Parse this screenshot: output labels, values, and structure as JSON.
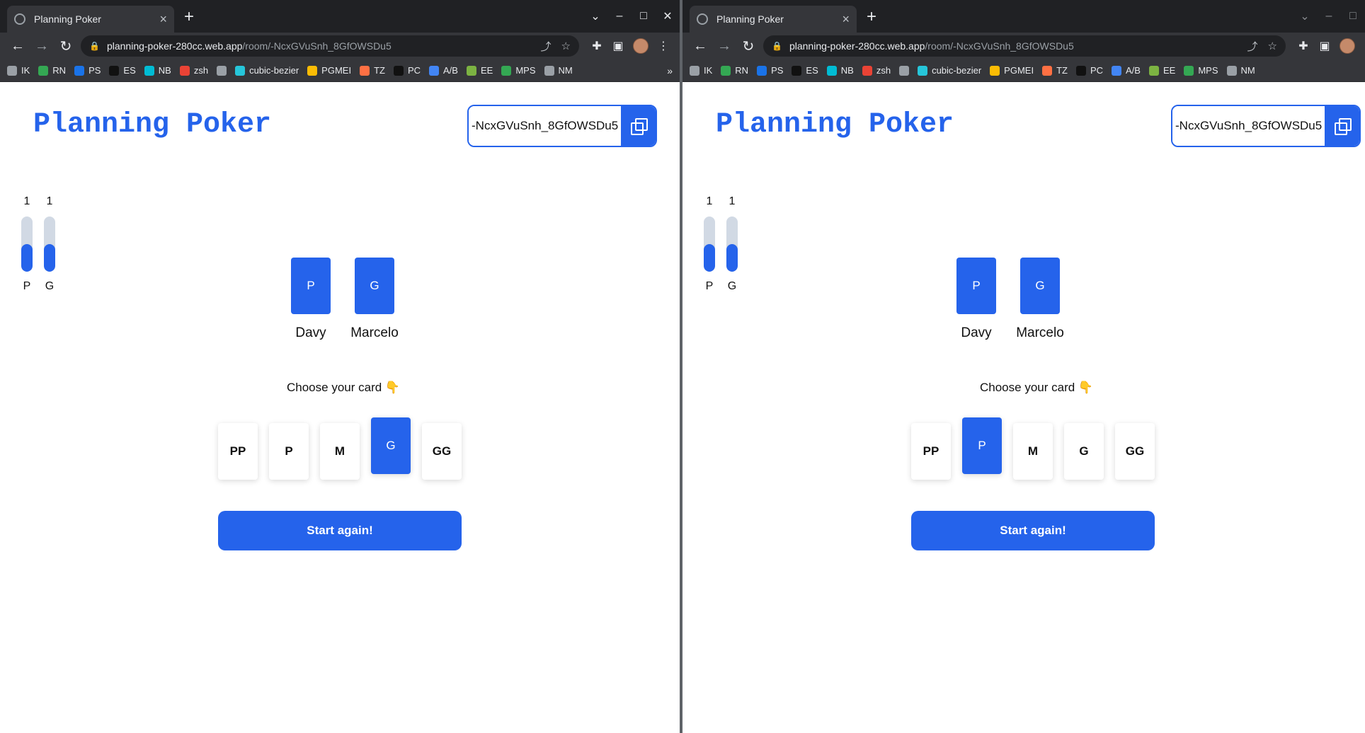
{
  "browser": {
    "tab_title": "Planning Poker",
    "new_tab": "+",
    "url_host": "planning-poker-280cc.web.app",
    "url_path": "/room/-NcxGVuSnh_8GfOWSDu5",
    "bookmarks": [
      {
        "label": "IK",
        "color": "#9aa0a6"
      },
      {
        "label": "RN",
        "color": "#34a853"
      },
      {
        "label": "PS",
        "color": "#1a73e8"
      },
      {
        "label": "ES",
        "color": "#111111"
      },
      {
        "label": "NB",
        "color": "#00bcd4"
      },
      {
        "label": "zsh",
        "color": "#ea4335"
      },
      {
        "label": "",
        "color": "#9aa0a6"
      },
      {
        "label": "cubic-bezier",
        "color": "#26c6da"
      },
      {
        "label": "PGMEI",
        "color": "#fbbc04"
      },
      {
        "label": "TZ",
        "color": "#ff7043"
      },
      {
        "label": "PC",
        "color": "#111111"
      },
      {
        "label": "A/B",
        "color": "#4285f4"
      },
      {
        "label": "EE",
        "color": "#7cb342"
      },
      {
        "label": "MPS",
        "color": "#34a853"
      },
      {
        "label": "NM",
        "color": "#9aa0a6"
      }
    ],
    "bookmarks_overflow": "»"
  },
  "app": {
    "title": "Planning Poker",
    "room_id": "-NcxGVuSnh_8GfOWSDu5",
    "choose_label": "Choose your card",
    "choose_emoji": "👇",
    "start_again": "Start again!",
    "stats": [
      {
        "count": "1",
        "label": "P",
        "level": 0.5
      },
      {
        "count": "1",
        "label": "G",
        "level": 0.5
      }
    ],
    "players": [
      {
        "name": "Davy",
        "card": "P"
      },
      {
        "name": "Marcelo",
        "card": "G"
      }
    ],
    "deck": [
      "PP",
      "P",
      "M",
      "G",
      "GG"
    ]
  },
  "windows": [
    {
      "selected_card": "G"
    },
    {
      "selected_card": "P"
    }
  ],
  "colors": {
    "accent": "#2563eb",
    "bar_track": "#d1d9e4"
  }
}
